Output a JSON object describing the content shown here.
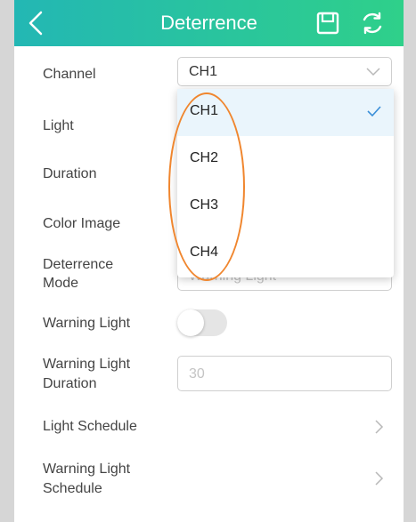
{
  "header": {
    "title": "Deterrence",
    "back_icon": "back-chevron-icon",
    "save_icon": "save-icon",
    "refresh_icon": "refresh-icon",
    "gradient": [
      "#23b7b4",
      "#2fd08a"
    ]
  },
  "settings": {
    "channel_label": "Channel",
    "channel_value": "CH1",
    "light_label": "Light",
    "duration_label": "Duration",
    "color_image_label": "Color Image",
    "deterrence_mode_label_1": "Deterrence",
    "deterrence_mode_label_2": "Mode",
    "deterrence_mode_value": "Warning Light",
    "warning_light_label": "Warning Light",
    "warning_light_on": false,
    "warning_light_duration_label_1": "Warning Light",
    "warning_light_duration_label_2": "Duration",
    "warning_light_duration_placeholder": "30",
    "light_schedule_label": "Light Schedule",
    "warning_light_schedule_label_1": "Warning Light",
    "warning_light_schedule_label_2": "Schedule"
  },
  "dropdown": {
    "options": [
      "CH1",
      "CH2",
      "CH3",
      "CH4"
    ],
    "selected": "CH1",
    "selected_bg": "#eaf5fc",
    "check_color": "#3b8fd8"
  },
  "annotation": {
    "shape": "oval",
    "color": "#f0862e"
  }
}
